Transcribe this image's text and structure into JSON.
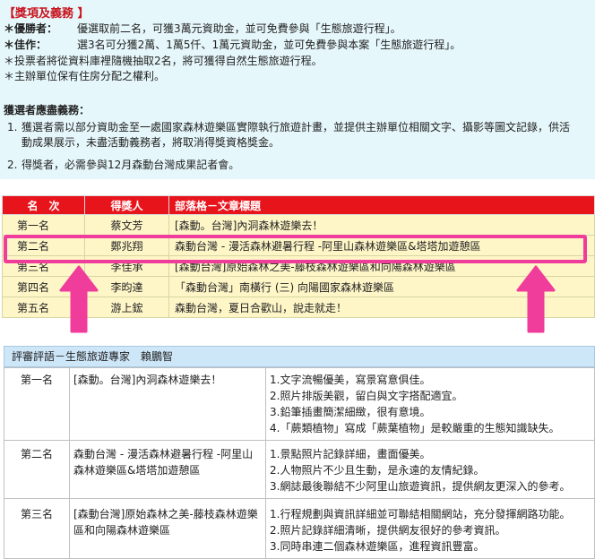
{
  "awards": {
    "title": "【獎項及義務 】",
    "excellent_label": "＊優勝者：",
    "excellent_text": "優選取前二名，可獲3萬元資助金，並可免費參與「生態旅遊行程」。",
    "merit_label": "＊佳作：",
    "merit_text": "選3名可分獲2萬、1萬5仟、1萬元資助金，並可免費參與本案「生態旅遊行程」。",
    "note1": "＊投票者將從資料庫裡隨機抽取2名，將可獲得自然生態旅遊行程。",
    "note2": "＊主辦單位保有住房分配之權利。"
  },
  "duties": {
    "title": "獲選者應盡義務：",
    "items": [
      {
        "num": "1.",
        "text": "獲選者需以部分資助金至一處國家森林遊樂區實際執行旅遊計畫，並提供主辦單位相關文字、攝影等圖文記錄，供活動成果展示，未盡活動義務者，將取消得獎資格獎金。"
      },
      {
        "num": "2.",
        "text": "得獎者，必需參與12月森動台灣成果記者會。"
      }
    ]
  },
  "winners": {
    "headers": [
      "名　次",
      "得獎人",
      "部落格－文章標題"
    ],
    "rows": [
      {
        "rank": "第一名",
        "name": "蔡文芳",
        "title": "[森動。台灣]內洞森林遊樂去！"
      },
      {
        "rank": "第二名",
        "name": "鄭兆翔",
        "title": "森動台灣 - 漫活森林避暑行程 -阿里山森林遊樂區&塔塔加遊憩區"
      },
      {
        "rank": "第三名",
        "name": "李佳承",
        "title": "[森動台灣]原始森林之美-藤枝森林遊樂區和向陽森林遊樂區"
      },
      {
        "rank": "第四名",
        "name": "李昀達",
        "title": "「森動台灣」南橫行 (三) 向陽國家森林遊樂區"
      },
      {
        "rank": "第五名",
        "name": "游上鋐",
        "title": "森動台灣，夏日合歡山，說走就走！"
      }
    ]
  },
  "review": {
    "header": "評審評語－生態旅遊專家　賴鵬智",
    "rows": [
      {
        "rank": "第一名",
        "title": "[森動。台灣]內洞森林遊樂去！",
        "comments": [
          "1.文字流暢優美，寫景寫意俱佳。",
          "2.照片排版美觀，留白與文字搭配適宜。",
          "3.鉛筆插畫簡潔細緻，很有意境。",
          "4.「蕨類植物」寫成「蕨葉植物」是較嚴重的生態知識缺失。"
        ]
      },
      {
        "rank": "第二名",
        "title": "森動台灣 - 漫活森林避暑行程 -阿里山森林遊樂區&塔塔加遊憩區",
        "comments": [
          "1.景點照片記錄詳細，畫面優美。",
          "2.人物照片不少且生動，是永遠的友情紀錄。",
          "3.網誌最後聯結不少阿里山旅遊資訊，提供網友更深入的參考。"
        ]
      },
      {
        "rank": "第三名",
        "title": "[森動台灣]原始森林之美-藤枝森林遊樂區和向陽森林遊樂區",
        "comments": [
          "1.行程規劃與資訊詳細並可聯結相關網站，充分發揮網路功能。",
          "2.照片記錄詳細清晰，提供網友很好的參考資訊。",
          "3.同時串連二個森林遊樂區，進程資訊豐富。"
        ]
      }
    ]
  },
  "colors": {
    "header_red": "#e8141c",
    "highlight_pink": "#f03c9a",
    "row_yellow": "#fff6c8",
    "panel_blue": "#e6f7fb"
  }
}
